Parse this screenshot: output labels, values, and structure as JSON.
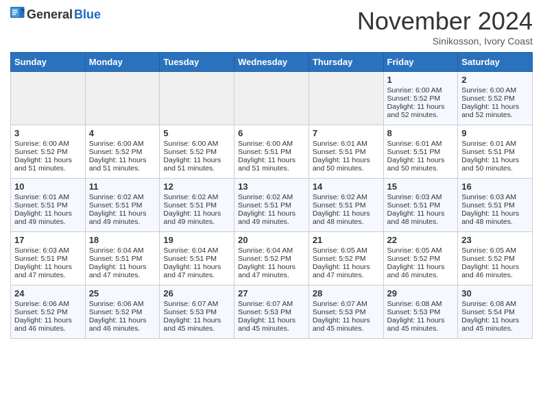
{
  "header": {
    "logo_general": "General",
    "logo_blue": "Blue",
    "title": "November 2024",
    "subtitle": "Sinikosson, Ivory Coast"
  },
  "days_of_week": [
    "Sunday",
    "Monday",
    "Tuesday",
    "Wednesday",
    "Thursday",
    "Friday",
    "Saturday"
  ],
  "weeks": [
    [
      {
        "day": "",
        "info": ""
      },
      {
        "day": "",
        "info": ""
      },
      {
        "day": "",
        "info": ""
      },
      {
        "day": "",
        "info": ""
      },
      {
        "day": "",
        "info": ""
      },
      {
        "day": "1",
        "info": "Sunrise: 6:00 AM\nSunset: 5:52 PM\nDaylight: 11 hours\nand 52 minutes."
      },
      {
        "day": "2",
        "info": "Sunrise: 6:00 AM\nSunset: 5:52 PM\nDaylight: 11 hours\nand 52 minutes."
      }
    ],
    [
      {
        "day": "3",
        "info": "Sunrise: 6:00 AM\nSunset: 5:52 PM\nDaylight: 11 hours\nand 51 minutes."
      },
      {
        "day": "4",
        "info": "Sunrise: 6:00 AM\nSunset: 5:52 PM\nDaylight: 11 hours\nand 51 minutes."
      },
      {
        "day": "5",
        "info": "Sunrise: 6:00 AM\nSunset: 5:52 PM\nDaylight: 11 hours\nand 51 minutes."
      },
      {
        "day": "6",
        "info": "Sunrise: 6:00 AM\nSunset: 5:51 PM\nDaylight: 11 hours\nand 51 minutes."
      },
      {
        "day": "7",
        "info": "Sunrise: 6:01 AM\nSunset: 5:51 PM\nDaylight: 11 hours\nand 50 minutes."
      },
      {
        "day": "8",
        "info": "Sunrise: 6:01 AM\nSunset: 5:51 PM\nDaylight: 11 hours\nand 50 minutes."
      },
      {
        "day": "9",
        "info": "Sunrise: 6:01 AM\nSunset: 5:51 PM\nDaylight: 11 hours\nand 50 minutes."
      }
    ],
    [
      {
        "day": "10",
        "info": "Sunrise: 6:01 AM\nSunset: 5:51 PM\nDaylight: 11 hours\nand 49 minutes."
      },
      {
        "day": "11",
        "info": "Sunrise: 6:02 AM\nSunset: 5:51 PM\nDaylight: 11 hours\nand 49 minutes."
      },
      {
        "day": "12",
        "info": "Sunrise: 6:02 AM\nSunset: 5:51 PM\nDaylight: 11 hours\nand 49 minutes."
      },
      {
        "day": "13",
        "info": "Sunrise: 6:02 AM\nSunset: 5:51 PM\nDaylight: 11 hours\nand 49 minutes."
      },
      {
        "day": "14",
        "info": "Sunrise: 6:02 AM\nSunset: 5:51 PM\nDaylight: 11 hours\nand 48 minutes."
      },
      {
        "day": "15",
        "info": "Sunrise: 6:03 AM\nSunset: 5:51 PM\nDaylight: 11 hours\nand 48 minutes."
      },
      {
        "day": "16",
        "info": "Sunrise: 6:03 AM\nSunset: 5:51 PM\nDaylight: 11 hours\nand 48 minutes."
      }
    ],
    [
      {
        "day": "17",
        "info": "Sunrise: 6:03 AM\nSunset: 5:51 PM\nDaylight: 11 hours\nand 47 minutes."
      },
      {
        "day": "18",
        "info": "Sunrise: 6:04 AM\nSunset: 5:51 PM\nDaylight: 11 hours\nand 47 minutes."
      },
      {
        "day": "19",
        "info": "Sunrise: 6:04 AM\nSunset: 5:51 PM\nDaylight: 11 hours\nand 47 minutes."
      },
      {
        "day": "20",
        "info": "Sunrise: 6:04 AM\nSunset: 5:52 PM\nDaylight: 11 hours\nand 47 minutes."
      },
      {
        "day": "21",
        "info": "Sunrise: 6:05 AM\nSunset: 5:52 PM\nDaylight: 11 hours\nand 47 minutes."
      },
      {
        "day": "22",
        "info": "Sunrise: 6:05 AM\nSunset: 5:52 PM\nDaylight: 11 hours\nand 46 minutes."
      },
      {
        "day": "23",
        "info": "Sunrise: 6:05 AM\nSunset: 5:52 PM\nDaylight: 11 hours\nand 46 minutes."
      }
    ],
    [
      {
        "day": "24",
        "info": "Sunrise: 6:06 AM\nSunset: 5:52 PM\nDaylight: 11 hours\nand 46 minutes."
      },
      {
        "day": "25",
        "info": "Sunrise: 6:06 AM\nSunset: 5:52 PM\nDaylight: 11 hours\nand 46 minutes."
      },
      {
        "day": "26",
        "info": "Sunrise: 6:07 AM\nSunset: 5:53 PM\nDaylight: 11 hours\nand 45 minutes."
      },
      {
        "day": "27",
        "info": "Sunrise: 6:07 AM\nSunset: 5:53 PM\nDaylight: 11 hours\nand 45 minutes."
      },
      {
        "day": "28",
        "info": "Sunrise: 6:07 AM\nSunset: 5:53 PM\nDaylight: 11 hours\nand 45 minutes."
      },
      {
        "day": "29",
        "info": "Sunrise: 6:08 AM\nSunset: 5:53 PM\nDaylight: 11 hours\nand 45 minutes."
      },
      {
        "day": "30",
        "info": "Sunrise: 6:08 AM\nSunset: 5:54 PM\nDaylight: 11 hours\nand 45 minutes."
      }
    ]
  ]
}
